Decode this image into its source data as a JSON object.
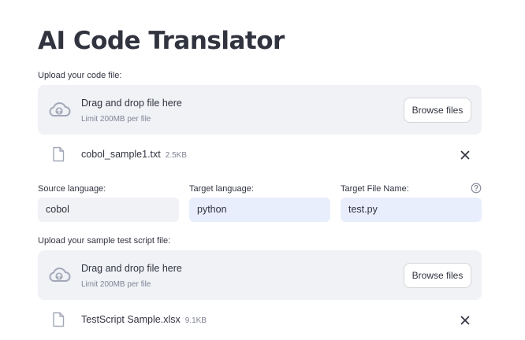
{
  "title": "AI Code Translator",
  "code_upload": {
    "label": "Upload your code file:",
    "dropzone": {
      "text": "Drag and drop file here",
      "limit": "Limit 200MB per file",
      "button": "Browse files",
      "icon": "cloud-upload-icon"
    },
    "file": {
      "name": "cobol_sample1.txt",
      "size": "2.5KB"
    }
  },
  "fields": {
    "source": {
      "label": "Source language:",
      "value": "cobol"
    },
    "target": {
      "label": "Target language:",
      "value": "python"
    },
    "target_file": {
      "label": "Target File Name:",
      "value": "test.py"
    }
  },
  "test_upload": {
    "label": "Upload your sample test script file:",
    "dropzone": {
      "text": "Drag and drop file here",
      "limit": "Limit 200MB per file",
      "button": "Browse files",
      "icon": "cloud-upload-icon"
    },
    "file": {
      "name": "TestScript Sample.xlsx",
      "size": "9.1KB"
    }
  },
  "colors": {
    "dropzone_bg": "#f0f2f6",
    "field_bg_default": "#f0f2f6",
    "field_bg_active": "#e8eefb",
    "text": "#31333f",
    "muted": "#808495"
  }
}
